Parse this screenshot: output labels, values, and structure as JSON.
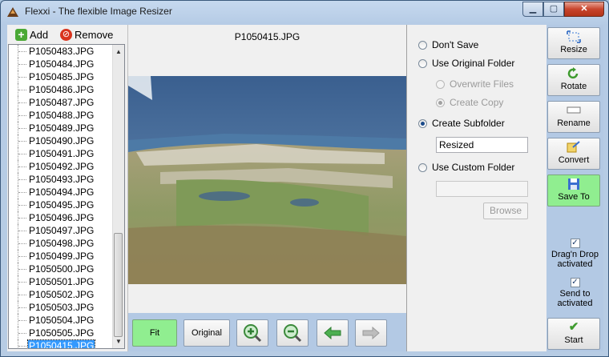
{
  "window": {
    "title": "Flexxi - The flexible Image Resizer"
  },
  "toolbar": {
    "add_label": "Add",
    "remove_label": "Remove"
  },
  "files": [
    "P1050483.JPG",
    "P1050484.JPG",
    "P1050485.JPG",
    "P1050486.JPG",
    "P1050487.JPG",
    "P1050488.JPG",
    "P1050489.JPG",
    "P1050490.JPG",
    "P1050491.JPG",
    "P1050492.JPG",
    "P1050493.JPG",
    "P1050494.JPG",
    "P1050495.JPG",
    "P1050496.JPG",
    "P1050497.JPG",
    "P1050498.JPG",
    "P1050499.JPG",
    "P1050500.JPG",
    "P1050501.JPG",
    "P1050502.JPG",
    "P1050503.JPG",
    "P1050504.JPG",
    "P1050505.JPG",
    "P1050415.JPG"
  ],
  "selected_file": "P1050415.JPG",
  "preview": {
    "filename": "P1050415.JPG",
    "fit_label": "Fit",
    "original_label": "Original"
  },
  "options": {
    "dont_save": "Don't Save",
    "use_original_folder": "Use Original Folder",
    "overwrite_files": "Overwrite Files",
    "create_copy": "Create Copy",
    "create_subfolder": "Create Subfolder",
    "subfolder_name": "Resized",
    "use_custom_folder": "Use Custom Folder",
    "custom_folder_path": "",
    "browse": "Browse"
  },
  "actions": {
    "resize": "Resize",
    "rotate": "Rotate",
    "rename": "Rename",
    "convert": "Convert",
    "save_to": "Save To",
    "dragdrop": "Drag'n Drop activated",
    "sendto": "Send to activated",
    "start": "Start"
  },
  "colors": {
    "active_button": "#90ee90",
    "panel_blue": "#b3c9e4",
    "selection": "#3399ff"
  }
}
